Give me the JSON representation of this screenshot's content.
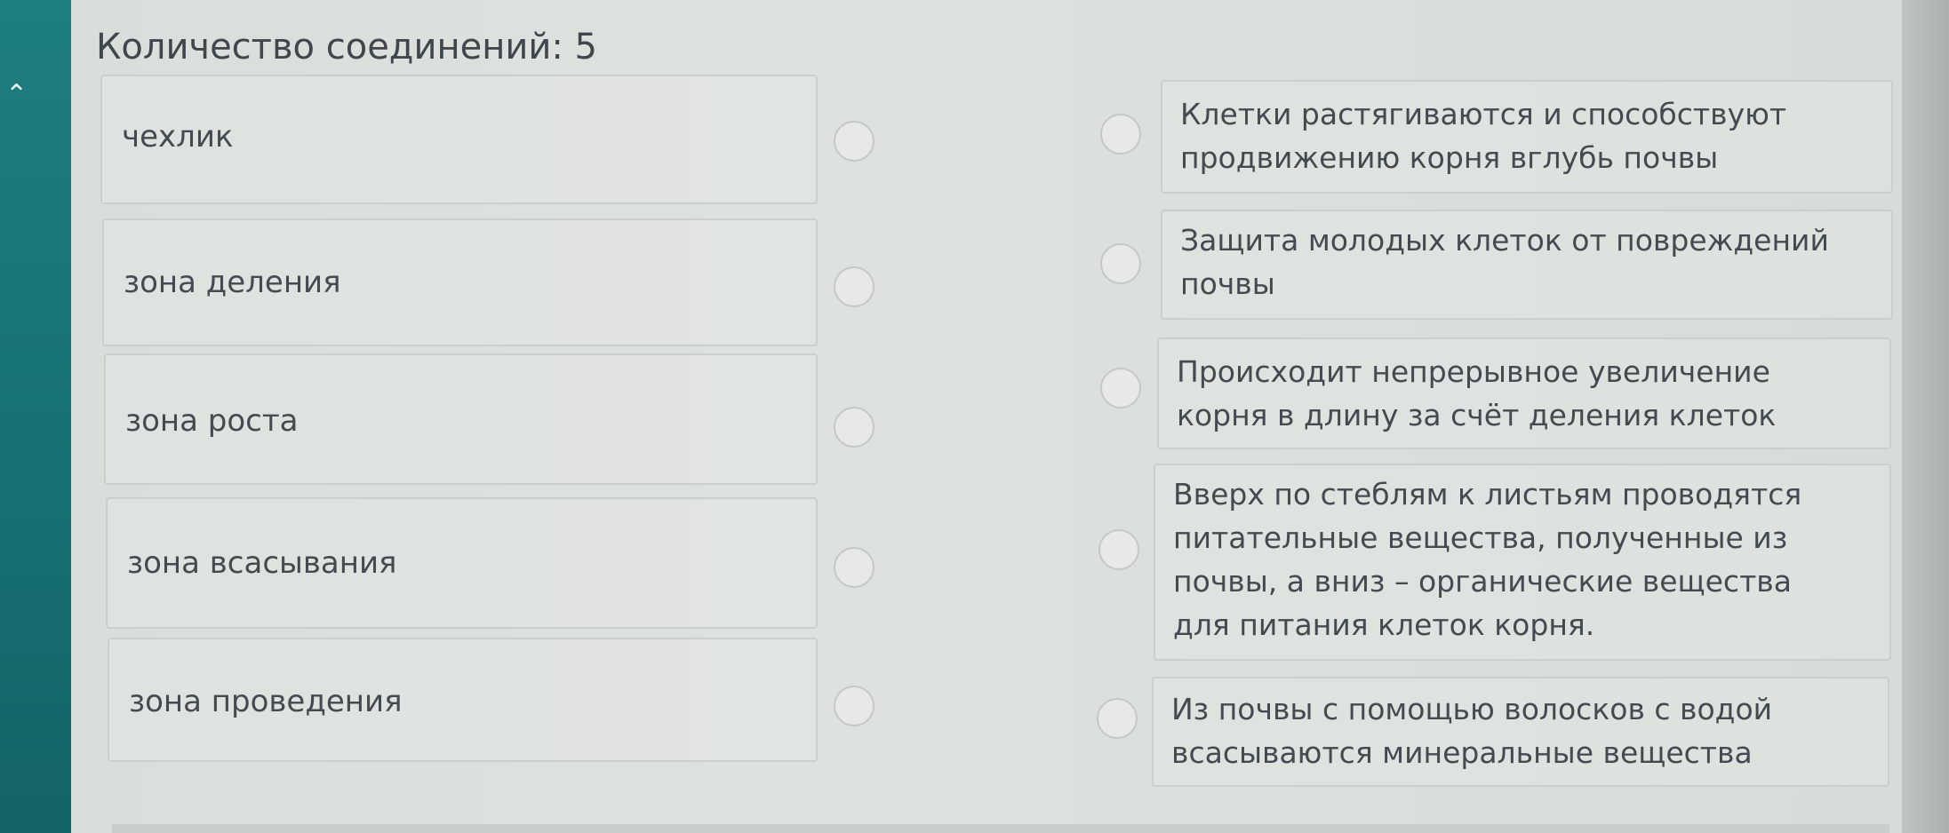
{
  "header": {
    "connections_label": "Количество соединений: 5"
  },
  "left_items": [
    {
      "label": "чехлик"
    },
    {
      "label": "зона деления"
    },
    {
      "label": "зона роста"
    },
    {
      "label": "зона всасывания"
    },
    {
      "label": "зона проведения"
    }
  ],
  "right_items": [
    {
      "label": "Клетки растягиваются и способствуют\nпродвижению корня вглубь почвы"
    },
    {
      "label": "Защита молодых клеток от повреждений\nпочвы"
    },
    {
      "label": "Происходит непрерывное увеличение\nкорня в длину за счёт деления клеток"
    },
    {
      "label": "Вверх по стеблям к листьям проводятся\nпитательные вещества, полученные из\nпочвы, а вниз – органические вещества\nдля питания клеток корня."
    },
    {
      "label": "Из почвы с помощью волосков с водой\nвсасываются минеральные вещества"
    }
  ]
}
